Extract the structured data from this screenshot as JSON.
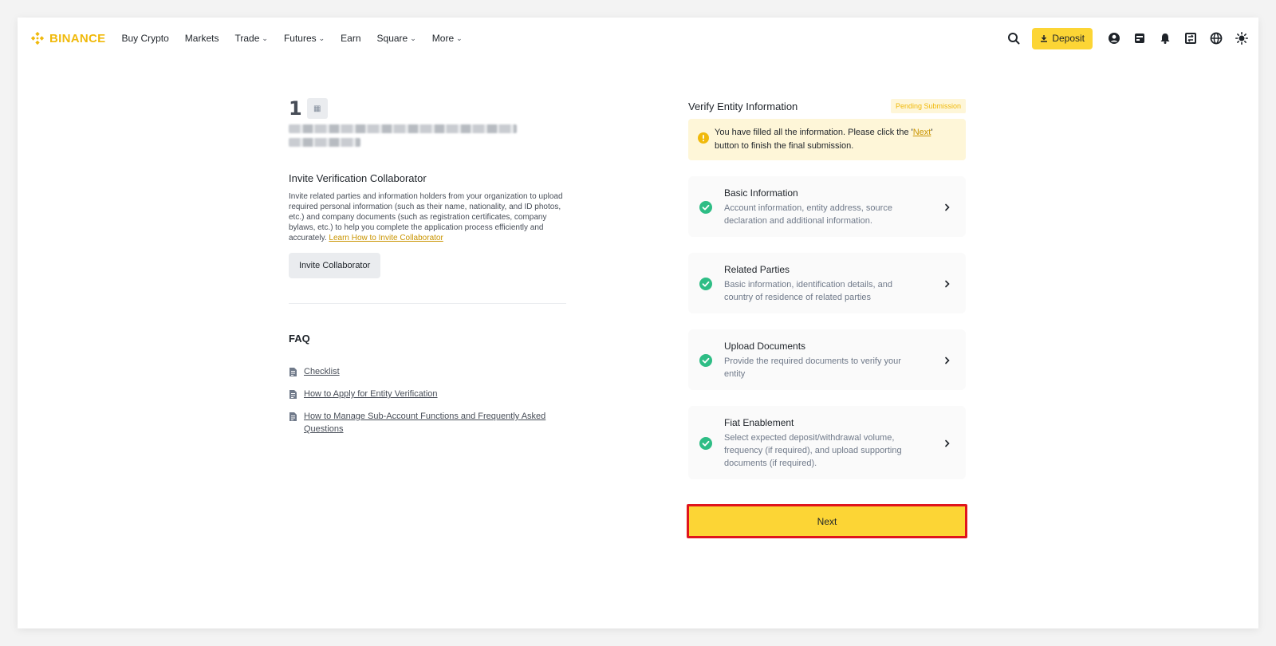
{
  "header": {
    "brand": "BINANCE",
    "nav": [
      {
        "label": "Buy Crypto",
        "dropdown": false
      },
      {
        "label": "Markets",
        "dropdown": false
      },
      {
        "label": "Trade",
        "dropdown": true
      },
      {
        "label": "Futures",
        "dropdown": true
      },
      {
        "label": "Earn",
        "dropdown": false
      },
      {
        "label": "Square",
        "dropdown": true
      },
      {
        "label": "More",
        "dropdown": true
      }
    ],
    "deposit_label": "Deposit",
    "icons": [
      "search-icon",
      "download-icon",
      "user-icon",
      "wallet-icon",
      "bell-icon",
      "transfer-icon",
      "globe-icon",
      "theme-icon"
    ]
  },
  "left": {
    "avatar_glyph": "1",
    "collab_title": "Invite Verification Collaborator",
    "collab_desc": "Invite related parties and information holders from your organization to upload required personal information (such as their name, nationality, and ID photos, etc.) and company documents (such as registration certificates, company bylaws, etc.) to help you complete the application process efficiently and accurately. ",
    "collab_link": "Learn How to Invite Collaborator",
    "invite_button": "Invite Collaborator",
    "faq_title": "FAQ",
    "faq": [
      "Checklist",
      "How to Apply for Entity Verification",
      "How to Manage Sub-Account Functions and Frequently Asked Questions"
    ]
  },
  "right": {
    "title": "Verify Entity Information",
    "status": "Pending Submission",
    "notice_before": "You have filled all the information. Please click the '",
    "notice_link": "Next",
    "notice_after": "' button to finish the final submission.",
    "steps": [
      {
        "title": "Basic Information",
        "desc": "Account information, entity address, source declaration and additional information."
      },
      {
        "title": "Related Parties",
        "desc": "Basic information, identification details, and country of residence of related parties"
      },
      {
        "title": "Upload Documents",
        "desc": "Provide the required documents to verify your entity"
      },
      {
        "title": "Fiat Enablement",
        "desc": "Select expected deposit/withdrawal volume, frequency (if required), and upload supporting documents (if required)."
      }
    ],
    "next_button": "Next"
  },
  "colors": {
    "brand": "#f0b90b",
    "button_yellow": "#fcd535",
    "success": "#2ebd85",
    "highlight_border": "#e0151c"
  }
}
